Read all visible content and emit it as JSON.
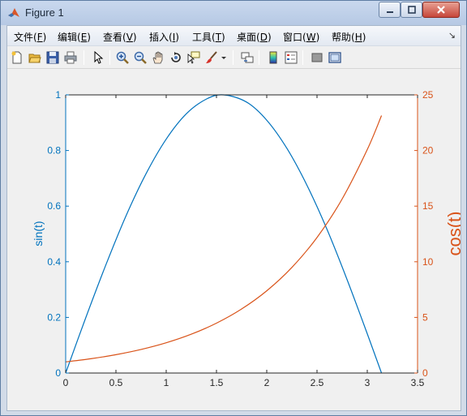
{
  "window": {
    "title": "Figure 1",
    "controls": {
      "minimize": "minimize",
      "maximize": "maximize",
      "close": "close"
    }
  },
  "menu": {
    "items": [
      {
        "label": "文件(",
        "key": "F",
        "end": ")"
      },
      {
        "label": "编辑(",
        "key": "E",
        "end": ")"
      },
      {
        "label": "查看(",
        "key": "V",
        "end": ")"
      },
      {
        "label": "插入(",
        "key": "I",
        "end": ")"
      },
      {
        "label": "工具(",
        "key": "T",
        "end": ")"
      },
      {
        "label": "桌面(",
        "key": "D",
        "end": ")"
      },
      {
        "label": "窗口(",
        "key": "W",
        "end": ")"
      },
      {
        "label": "帮助(",
        "key": "H",
        "end": ")"
      }
    ],
    "dock_arrow": "↘"
  },
  "toolbar": {
    "icons": [
      "new-figure-icon",
      "open-file-icon",
      "save-icon",
      "print-icon",
      "select-arrow-icon",
      "zoom-in-icon",
      "zoom-out-icon",
      "pan-hand-icon",
      "rotate-3d-icon",
      "data-cursor-icon",
      "brush-icon",
      "brush-dropdown-icon",
      "link-plot-icon",
      "colorbar-icon",
      "legend-icon",
      "hide-plot-tools-icon",
      "show-plot-tools-icon"
    ]
  },
  "colors": {
    "left_axis": "#0072bd",
    "right_axis": "#d95319",
    "axis_black": "#262626"
  },
  "chart_data": {
    "type": "line",
    "title": "",
    "xlabel": "",
    "ylabel_left": "sin(t)",
    "ylabel_right": "cos(t)",
    "xlim": [
      0,
      3.5
    ],
    "ylim_left": [
      0,
      1
    ],
    "ylim_right": [
      0,
      25
    ],
    "x_ticks": [
      "0",
      "0.5",
      "1",
      "1.5",
      "2",
      "2.5",
      "3",
      "3.5"
    ],
    "y_left_ticks": [
      "0",
      "0.2",
      "0.4",
      "0.6",
      "0.8",
      "1"
    ],
    "y_right_ticks": [
      "0",
      "5",
      "10",
      "15",
      "20",
      "25"
    ],
    "grid": false,
    "series": [
      {
        "axis": "left",
        "x": [
          0,
          0.2,
          0.4,
          0.6,
          0.8,
          1.0,
          1.2,
          1.4,
          1.5708,
          1.8,
          2.0,
          2.2,
          2.4,
          2.6,
          2.8,
          3.0,
          3.1416
        ],
        "values": [
          0,
          0.199,
          0.389,
          0.565,
          0.717,
          0.841,
          0.932,
          0.985,
          1.0,
          0.974,
          0.909,
          0.808,
          0.675,
          0.516,
          0.335,
          0.141,
          0
        ]
      },
      {
        "axis": "right",
        "x": [
          0,
          0.25,
          0.5,
          0.75,
          1.0,
          1.25,
          1.5,
          1.75,
          2.0,
          2.25,
          2.5,
          2.75,
          3.0,
          3.1416
        ],
        "values": [
          1.0,
          1.284,
          1.649,
          2.117,
          2.718,
          3.49,
          4.482,
          5.755,
          7.389,
          9.488,
          12.182,
          15.643,
          20.086,
          23.141
        ]
      }
    ]
  }
}
